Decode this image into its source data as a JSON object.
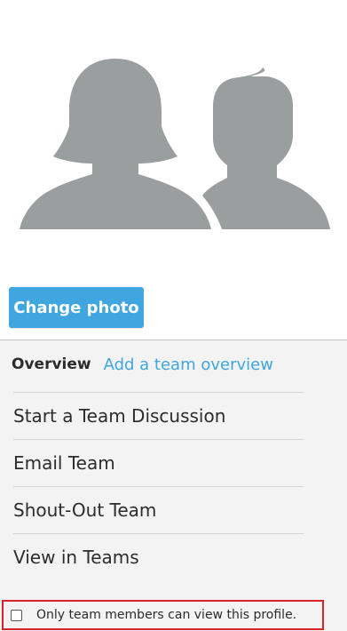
{
  "avatar": {
    "icon": "team-placeholder-icon",
    "color": "#9a9e9f"
  },
  "photo": {
    "change_label": "Change photo"
  },
  "overview": {
    "label": "Overview",
    "link_text": "Add a team overview"
  },
  "menu": {
    "items": [
      {
        "label": "Start a Team Discussion"
      },
      {
        "label": "Email Team"
      },
      {
        "label": "Shout-Out Team"
      },
      {
        "label": "View in Teams"
      }
    ]
  },
  "privacy": {
    "label": "Only team members can view this profile.",
    "checked": false
  },
  "colors": {
    "accent": "#3fa6e0",
    "highlight_border": "#d6262c",
    "panel_bg": "#f3f3f3"
  }
}
